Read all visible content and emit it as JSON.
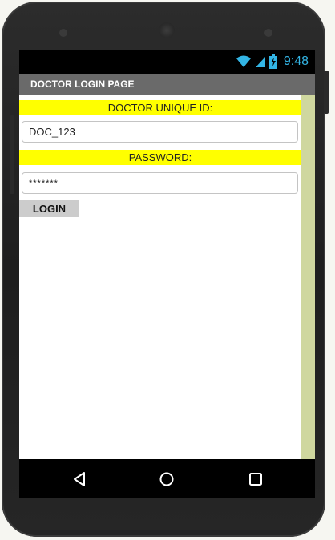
{
  "status_bar": {
    "time": "9:48",
    "wifi_icon": "wifi-icon",
    "signal_icon": "signal-icon",
    "battery_icon": "battery-charging-icon",
    "icon_color": "#33b5e5"
  },
  "app_bar": {
    "title": "DOCTOR LOGIN PAGE",
    "background": "#6a6a6a"
  },
  "form": {
    "id_label": "DOCTOR UNIQUE ID:",
    "id_value": "DOC_123",
    "password_label": "PASSWORD:",
    "password_value": "*******",
    "login_label": "LOGIN",
    "label_background": "#ffff00",
    "button_background": "#cccccc"
  },
  "nav_bar": {
    "back_icon": "back-triangle-icon",
    "home_icon": "home-circle-icon",
    "recents_icon": "recents-square-icon"
  }
}
